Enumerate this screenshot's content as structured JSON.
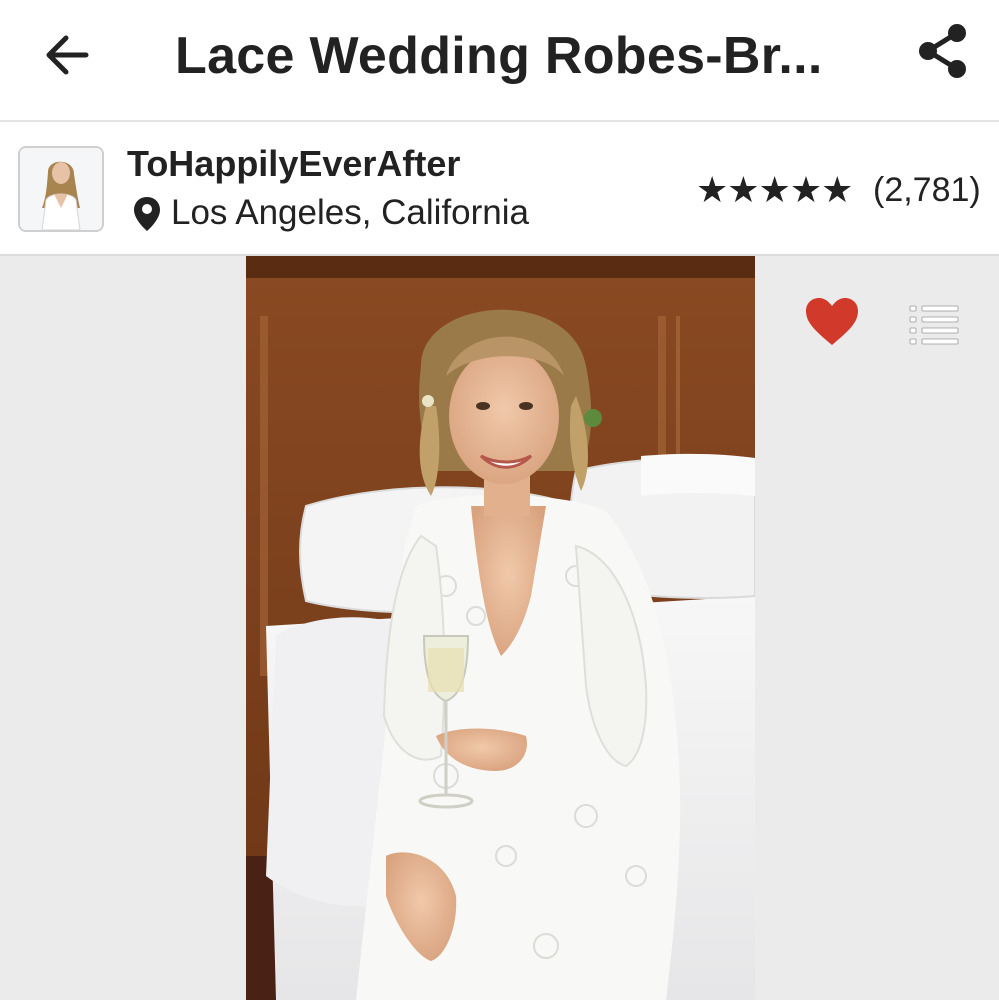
{
  "header": {
    "title": "Lace Wedding Robes-Br...",
    "back_icon": "arrow-left-icon",
    "share_icon": "share-icon"
  },
  "shop": {
    "name": "ToHappilyEverAfter",
    "location": "Los Angeles, California",
    "location_icon": "map-pin-icon",
    "rating_stars": "★★★★★",
    "rating_value": 5,
    "review_count": "(2,781)"
  },
  "gallery": {
    "favorite_icon": "heart-icon",
    "favorite_color": "#d13a2a",
    "list_icon": "list-icon",
    "background": "#ebebeb"
  }
}
